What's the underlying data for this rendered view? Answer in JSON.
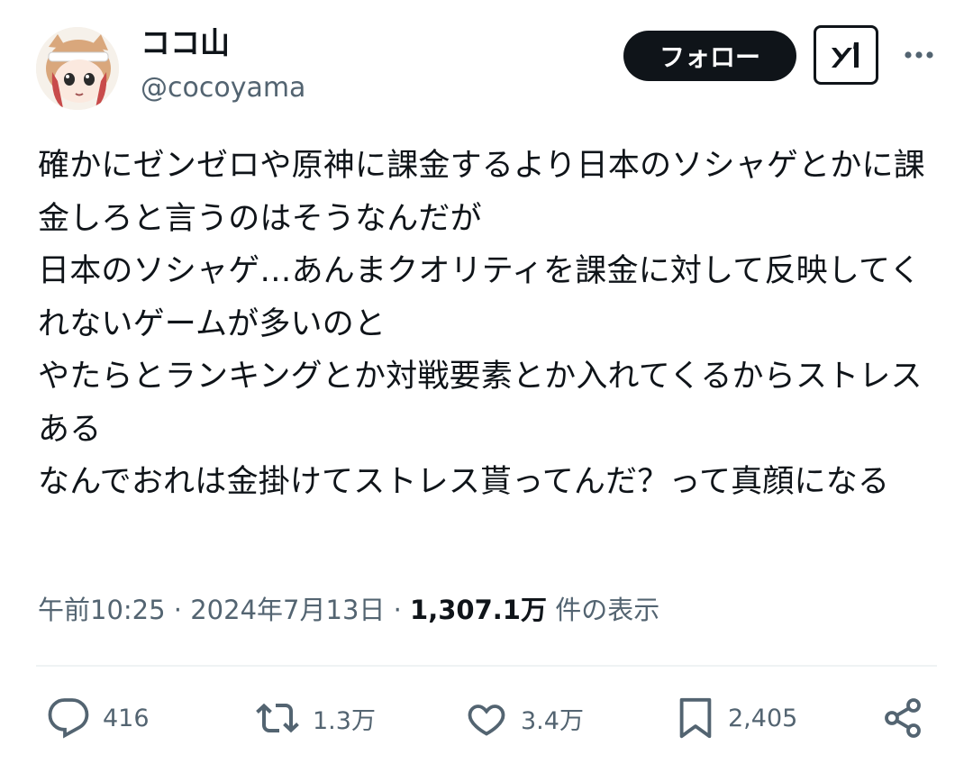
{
  "author": {
    "display_name": "ココ山",
    "handle": "@cocoyama"
  },
  "header": {
    "follow_label": "フォロー"
  },
  "tweet": {
    "text": "確かにゼンゼロや原神に課金するより日本のソシャゲとかに課金しろと言うのはそうなんだが\n日本のソシャゲ…あんまクオリティを課金に対して反映してくれないゲームが多いのと\nやたらとランキングとか対戦要素とか入れてくるからストレスある\nなんでおれは金掛けてストレス貰ってんだ？って真顔になる",
    "time": "午前10:25",
    "separator": "·",
    "date": "2024年7月13日",
    "views_count": "1,307.1万",
    "views_label": "件の表示"
  },
  "actions": {
    "reply": {
      "icon": "reply-icon",
      "count": "416"
    },
    "retweet": {
      "icon": "retweet-icon",
      "count": "1.3万"
    },
    "like": {
      "icon": "heart-icon",
      "count": "3.4万"
    },
    "bookmark": {
      "icon": "bookmark-icon",
      "count": "2,405"
    },
    "share": {
      "icon": "share-icon"
    }
  },
  "colors": {
    "text": "#0f1419",
    "secondary": "#536471",
    "button_bg": "#0f1419",
    "divider": "#eff3f4"
  }
}
